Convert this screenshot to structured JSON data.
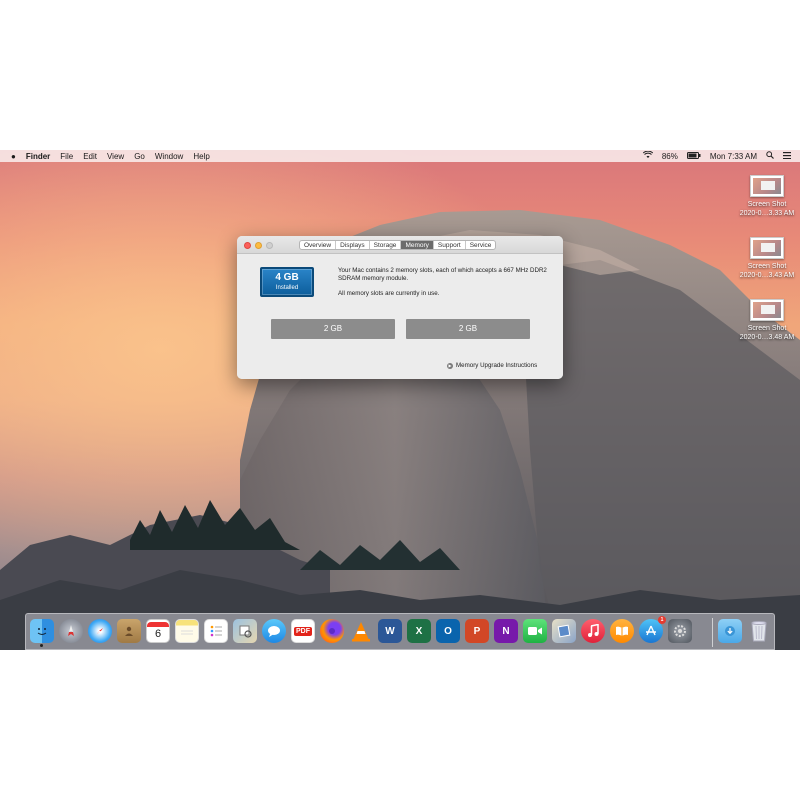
{
  "menubar": {
    "app": "Finder",
    "items": [
      "File",
      "Edit",
      "View",
      "Go",
      "Window",
      "Help"
    ],
    "battery": "86%",
    "clock": "Mon 7:33 AM"
  },
  "desktop_icons": [
    {
      "line1": "Screen Shot",
      "line2": "2020-0…3.33 AM"
    },
    {
      "line1": "Screen Shot",
      "line2": "2020-0…3.43 AM"
    },
    {
      "line1": "Screen Shot",
      "line2": "2020-0…3.48 AM"
    }
  ],
  "window": {
    "tabs": [
      "Overview",
      "Displays",
      "Storage",
      "Memory",
      "Support",
      "Service"
    ],
    "active_tab": "Memory",
    "installed_size": "4 GB",
    "installed_label": "Installed",
    "description": "Your Mac contains 2 memory slots, each of which accepts a 667 MHz DDR2 SDRAM memory module.",
    "usage_note": "All memory slots are currently in use.",
    "slots": [
      "2 GB",
      "2 GB"
    ],
    "upgrade_link": "Memory Upgrade Instructions"
  },
  "dock": {
    "calendar_day": "6",
    "appstore_badge": "1",
    "apps": [
      "Finder",
      "Launchpad",
      "Safari",
      "Contacts",
      "Calendar",
      "Notes",
      "Reminders",
      "Preview",
      "Messages",
      "PDF",
      "Firefox",
      "VLC",
      "Word",
      "Excel",
      "Outlook",
      "PowerPoint",
      "OneNote",
      "FaceTime",
      "Image Capture",
      "Music",
      "Books",
      "App Store",
      "System Preferences",
      "Downloads",
      "Trash"
    ],
    "pdf_label": "PDF",
    "word_label": "W",
    "excel_label": "X",
    "outlook_label": "O",
    "ppt_label": "P",
    "onenote_label": "N"
  },
  "colors": {
    "installed_box": "#1a70b4",
    "slot_bar": "#8c8c8c",
    "active_tab": "#6b6b6b"
  }
}
